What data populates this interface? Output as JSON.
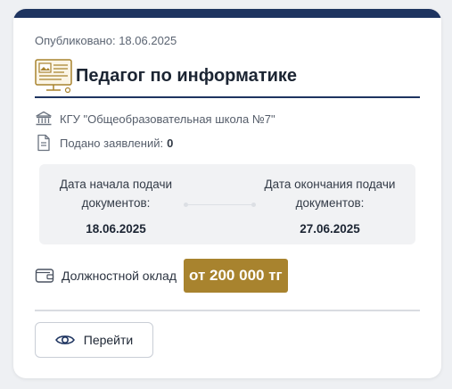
{
  "card": {
    "published": "Опубликовано: 18.06.2025",
    "title": "Педагог по информатике",
    "organization": "КГУ \"Общеобразовательная школа №7\"",
    "applications_label": "Подано заявлений:",
    "applications_count": "0",
    "start_label": "Дата начала подачи документов:",
    "start_date": "18.06.2025",
    "end_label": "Дата окончания подачи документов:",
    "end_date": "27.06.2025",
    "salary_label": "Должностной оклад",
    "salary_value": "от 200 000 тг",
    "button_label": "Перейти"
  },
  "icons": {
    "title": "monitor-lesson-icon",
    "organization": "institution-icon",
    "applications": "document-icon",
    "salary": "wallet-icon",
    "button": "eye-icon"
  },
  "colors": {
    "accent": "#1e3460",
    "salary_badge": "#a8832e"
  }
}
